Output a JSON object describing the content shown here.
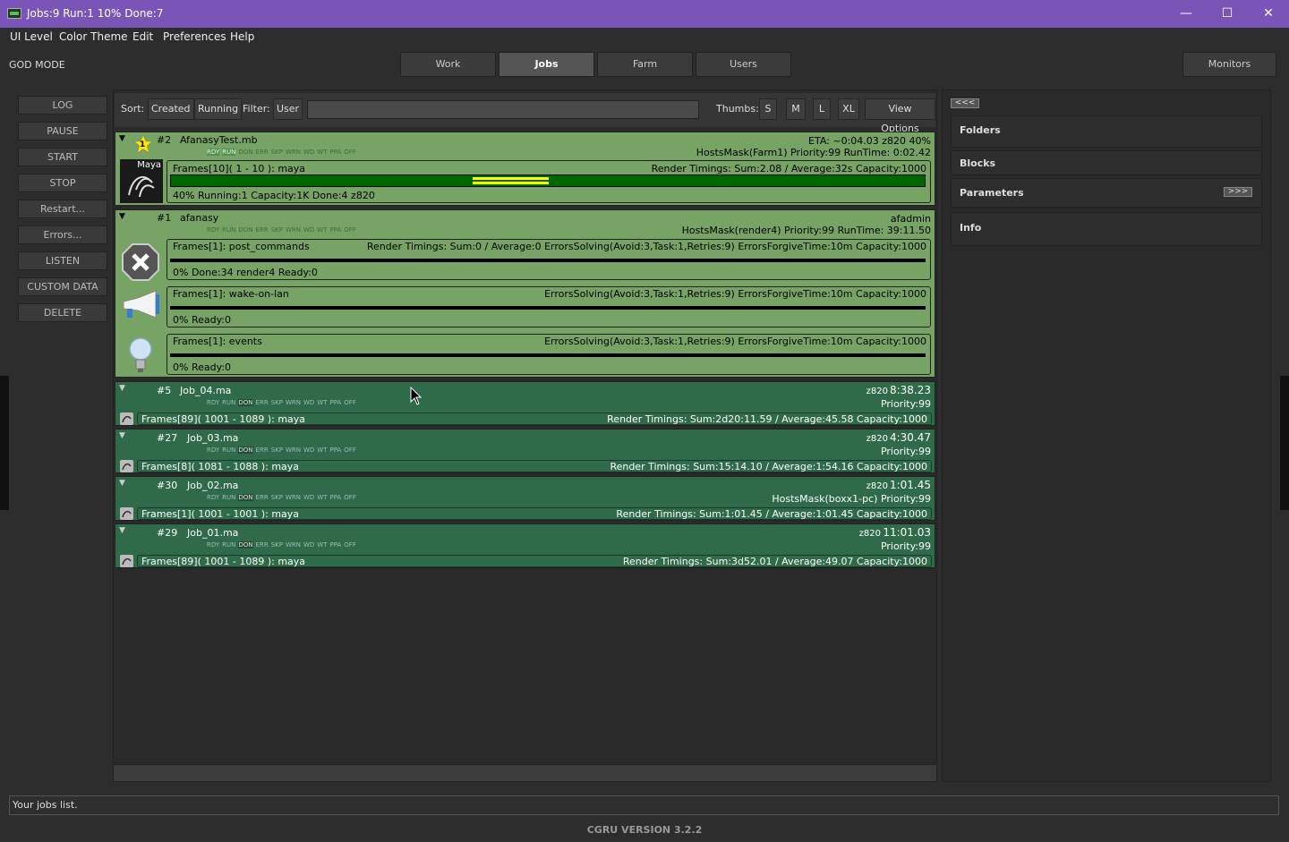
{
  "window": {
    "title": "Jobs:9 Run:1 10% Done:7"
  },
  "menu": [
    "UI Level",
    "Color Theme",
    "Edit",
    "Preferences",
    "Help"
  ],
  "mode": "GOD MODE",
  "tabs": [
    "Work",
    "Jobs",
    "Farm",
    "Users"
  ],
  "monitors_label": "Monitors",
  "side_buttons": [
    "LOG",
    "PAUSE",
    "START",
    "STOP",
    "Restart...",
    "Errors...",
    "LISTEN",
    "CUSTOM DATA",
    "DELETE"
  ],
  "toolbar": {
    "sort_label": "Sort:",
    "sort_created": "Created",
    "sort_running": "Running",
    "filter_label": "Filter:",
    "filter_user": "User",
    "filter_value": "",
    "thumbs_label": "Thumbs:",
    "thumb_s": "S",
    "thumb_m": "M",
    "thumb_l": "L",
    "thumb_xl": "XL",
    "view_options": "View Options"
  },
  "states": [
    "RDY",
    "RUN",
    "DON",
    "ERR",
    "SKP",
    "WRN",
    "WD",
    "WT",
    "PPA",
    "OFF"
  ],
  "jobs": [
    {
      "id": "#2",
      "name": "AfanasyTest.mb",
      "badge": "1",
      "eta": "ETA: ~0:04.03 z820 40%",
      "info": "HostsMask(Farm1) Priority:99 RunTime: 0:02.42",
      "thumb_label": "Maya",
      "blocks": [
        {
          "name": "Frames[10]( 1 - 10 ): maya",
          "timings": "Render Timings: Sum:2.08 / Average:32s Capacity:1000",
          "status": "40% Running:1 Capacity:1K Done:4 z820"
        }
      ]
    },
    {
      "id": "#1",
      "name": "afanasy",
      "user": "afadmin",
      "info": "HostsMask(render4) Priority:99 RunTime: 39:11.50",
      "blocks": [
        {
          "name": "Frames[1]: post_commands",
          "timings": "Render Timings: Sum:0 / Average:0 ErrorsSolving(Avoid:3,Task:1,Retries:9) ErrorsForgiveTime:10m Capacity:1000",
          "status": "0% Done:34 render4 Ready:0"
        },
        {
          "name": "Frames[1]: wake-on-lan",
          "timings": "ErrorsSolving(Avoid:3,Task:1,Retries:9) ErrorsForgiveTime:10m Capacity:1000",
          "status": "0% Ready:0"
        },
        {
          "name": "Frames[1]: events",
          "timings": "ErrorsSolving(Avoid:3,Task:1,Retries:9) ErrorsForgiveTime:10m Capacity:1000",
          "status": "0% Ready:0"
        }
      ]
    },
    {
      "id": "#5",
      "name": "Job_04.ma",
      "host": "z820",
      "time": "8:38.23",
      "info": "Priority:99",
      "block": "Frames[89]( 1001 - 1089 ): maya",
      "timings": "Render Timings: Sum:2d20:11.59 / Average:45.58 Capacity:1000"
    },
    {
      "id": "#27",
      "name": "Job_03.ma",
      "host": "z820",
      "time": "4:30.47",
      "info": "Priority:99",
      "block": "Frames[8]( 1081 - 1088 ): maya",
      "timings": "Render Timings: Sum:15:14.10 / Average:1:54.16 Capacity:1000"
    },
    {
      "id": "#30",
      "name": "Job_02.ma",
      "host": "z820",
      "time": "1:01.45",
      "info": "HostsMask(boxx1-pc) Priority:99",
      "block": "Frames[1]( 1001 - 1001 ): maya",
      "timings": "Render Timings: Sum:1:01.45 / Average:1:01.45 Capacity:1000"
    },
    {
      "id": "#29",
      "name": "Job_01.ma",
      "host": "z820",
      "time": "11:01.03",
      "info": "Priority:99",
      "block": "Frames[89]( 1001 - 1089 ): maya",
      "timings": "Render Timings: Sum:3d52.01 / Average:49.07 Capacity:1000"
    }
  ],
  "job_progress": {
    "job2_block_percent": 40
  },
  "right_panel": {
    "collapse": "<<<",
    "expand": ">>>",
    "sections": [
      "Folders",
      "Blocks",
      "Parameters",
      "Info"
    ]
  },
  "status": "Your jobs list.",
  "version": "CGRU VERSION 3.2.2",
  "colors": {
    "title_bar": "#7a55b8",
    "running_job": "#77a364",
    "done_job": "#2f6b48",
    "progress": "#ffff00"
  }
}
